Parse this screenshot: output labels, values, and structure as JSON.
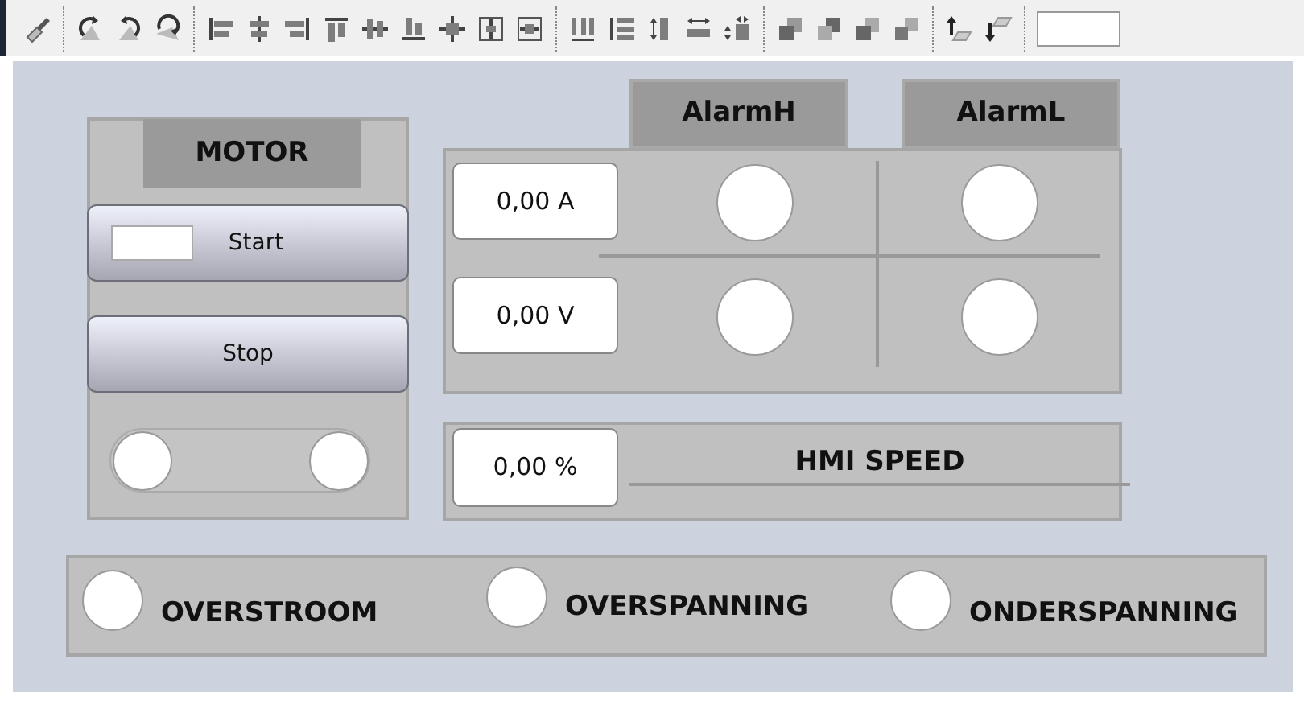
{
  "motor": {
    "title": "MOTOR",
    "buttons": [
      {
        "label": "Start",
        "kind": "with_field"
      },
      {
        "label": "Stop",
        "kind": "plain"
      }
    ],
    "switch": {
      "on": false
    }
  },
  "alarm_columns": [
    "AlarmH",
    "AlarmL"
  ],
  "measurements": [
    {
      "value": "0,00 A",
      "alarm_high": false,
      "alarm_low": false
    },
    {
      "value": "0,00 V",
      "alarm_high": false,
      "alarm_low": false
    }
  ],
  "speed": {
    "value": "0,00 %",
    "label": "HMI SPEED"
  },
  "alarms": [
    {
      "label": "OVERSTROOM",
      "on": false
    },
    {
      "label": "OVERSPANNING",
      "on": false
    },
    {
      "label": "ONDERSPANNING",
      "on": false
    }
  ]
}
